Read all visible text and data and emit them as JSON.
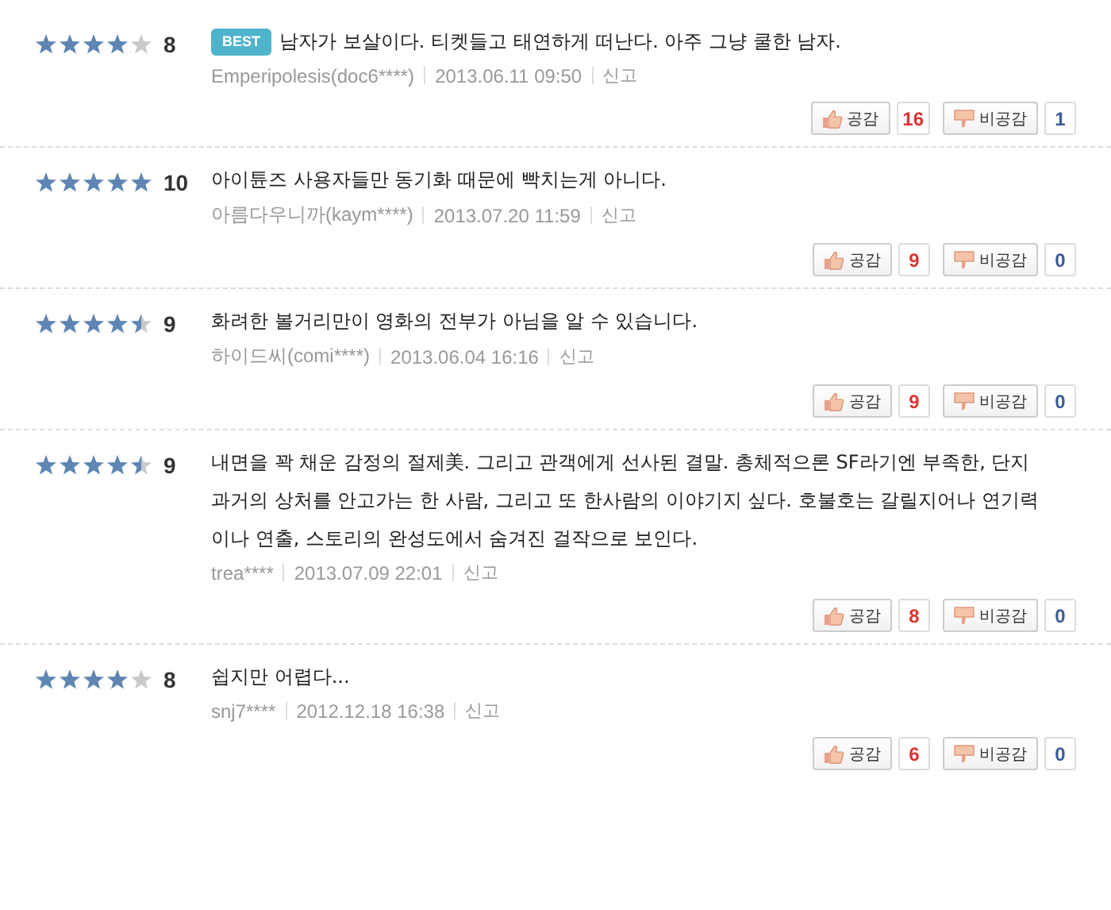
{
  "reviews": [
    {
      "stars": 4,
      "score": "8",
      "best": true,
      "badge": "BEST",
      "text": "남자가 보살이다. 티켓들고 태연하게 떠난다. 아주 그냥 쿨한 남자.",
      "author": "Emperipolesis(doc6****)",
      "date": "2013.06.11 09:50",
      "report": "신고",
      "like_label": "공감",
      "likes": "16",
      "dislike_label": "비공감",
      "dislikes": "1"
    },
    {
      "stars": 5,
      "score": "10",
      "best": false,
      "text": "아이튠즈 사용자들만 동기화 때문에 빡치는게 아니다.",
      "author": "아름다우니까(kaym****)",
      "date": "2013.07.20 11:59",
      "report": "신고",
      "like_label": "공감",
      "likes": "9",
      "dislike_label": "비공감",
      "dislikes": "0"
    },
    {
      "stars": 4.5,
      "score": "9",
      "best": false,
      "text": "화려한 볼거리만이 영화의 전부가 아님을 알 수 있습니다.",
      "author": "하이드씨(comi****)",
      "date": "2013.06.04 16:16",
      "report": "신고",
      "like_label": "공감",
      "likes": "9",
      "dislike_label": "비공감",
      "dislikes": "0"
    },
    {
      "stars": 4.5,
      "score": "9",
      "best": false,
      "text": "내면을 꽉 채운 감정의 절제美. 그리고 관객에게 선사된 결말. 총체적으론 SF라기엔 부족한, 단지 과거의 상처를 안고가는 한 사람, 그리고 또 한사람의 이야기지 싶다. 호불호는 갈릴지어나 연기력이나 연출, 스토리의 완성도에서 숨겨진 걸작으로 보인다.",
      "author": "trea****",
      "date": "2013.07.09 22:01",
      "report": "신고",
      "like_label": "공감",
      "likes": "8",
      "dislike_label": "비공감",
      "dislikes": "0"
    },
    {
      "stars": 4,
      "score": "8",
      "best": false,
      "text": "쉽지만 어렵다...",
      "author": "snj7****",
      "date": "2012.12.18 16:38",
      "report": "신고",
      "like_label": "공감",
      "likes": "6",
      "dislike_label": "비공감",
      "dislikes": "0"
    }
  ]
}
